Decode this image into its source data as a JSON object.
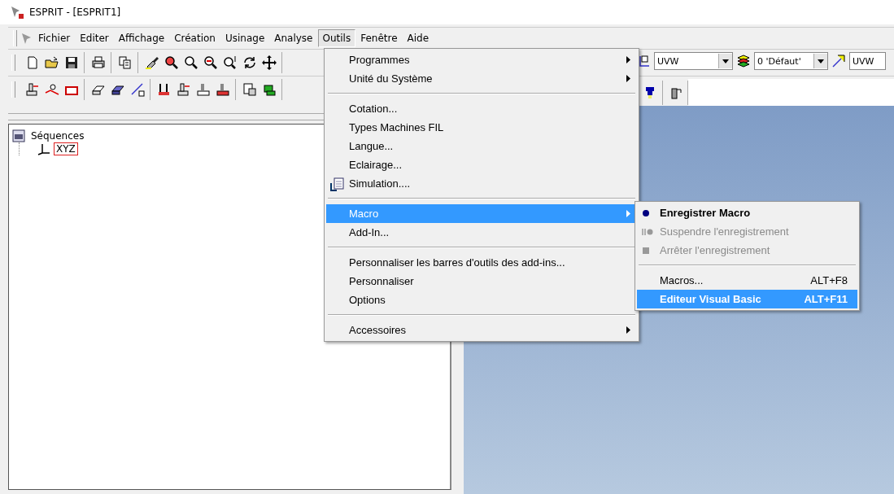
{
  "window": {
    "title": "ESPRIT - [ESPRIT1]"
  },
  "menubar": [
    {
      "label": "Fichier",
      "selected": false
    },
    {
      "label": "Editer",
      "selected": false
    },
    {
      "label": "Affichage",
      "selected": false
    },
    {
      "label": "Création",
      "selected": false
    },
    {
      "label": "Usinage",
      "selected": false
    },
    {
      "label": "Analyse",
      "selected": false
    },
    {
      "label": "Outils",
      "selected": true
    },
    {
      "label": "Fenêtre",
      "selected": false
    },
    {
      "label": "Aide",
      "selected": false
    }
  ],
  "toolbar": {
    "combos": [
      {
        "kind": "combo",
        "value": "UVW"
      },
      {
        "kind": "combo",
        "value": "0 'Défaut'"
      },
      {
        "kind": "field",
        "value": "UVW"
      }
    ]
  },
  "tree": {
    "items": [
      {
        "label": "Séquences",
        "children": [
          {
            "label": "XYZ",
            "selected": true
          }
        ]
      }
    ]
  },
  "outils_menu": {
    "items": [
      {
        "kind": "item",
        "label": "Programmes",
        "arrow": true,
        "selected": false
      },
      {
        "kind": "item",
        "label": "Unité du Système",
        "arrow": true,
        "selected": false
      },
      {
        "kind": "separator"
      },
      {
        "kind": "item",
        "label": "Cotation...",
        "selected": false
      },
      {
        "kind": "item",
        "label": "Types Machines FIL",
        "selected": false
      },
      {
        "kind": "item",
        "label": "Langue...",
        "selected": false
      },
      {
        "kind": "item",
        "label": "Eclairage...",
        "selected": false
      },
      {
        "kind": "item",
        "label": "Simulation....",
        "icon": true,
        "selected": false
      },
      {
        "kind": "separator"
      },
      {
        "kind": "item",
        "label": "Macro",
        "arrow": true,
        "selected": true
      },
      {
        "kind": "item",
        "label": "Add-In...",
        "selected": false
      },
      {
        "kind": "separator"
      },
      {
        "kind": "item",
        "label": "Personnaliser les barres d'outils des add-ins...",
        "selected": false
      },
      {
        "kind": "item",
        "label": "Personnaliser",
        "selected": false
      },
      {
        "kind": "item",
        "label": "Options",
        "selected": false
      },
      {
        "kind": "separator"
      },
      {
        "kind": "item",
        "label": "Accessoires",
        "arrow": true,
        "selected": false
      }
    ]
  },
  "macro_menu": {
    "items": [
      {
        "kind": "dot",
        "label": "Enregistrer Macro",
        "default": true,
        "disabled": false,
        "selected": false
      },
      {
        "kind": "pause",
        "label": "Suspendre l'enregistrement",
        "disabled": true,
        "selected": false
      },
      {
        "kind": "stop",
        "label": "Arrêter l'enregistrement",
        "disabled": true,
        "selected": false
      },
      {
        "kind": "separator"
      },
      {
        "kind": "item",
        "label": "Macros...",
        "shortcut": "ALT+F8",
        "disabled": false,
        "selected": false
      },
      {
        "kind": "item",
        "label": "Editeur Visual Basic",
        "shortcut": "ALT+F11",
        "default": true,
        "disabled": false,
        "selected": true
      }
    ]
  }
}
